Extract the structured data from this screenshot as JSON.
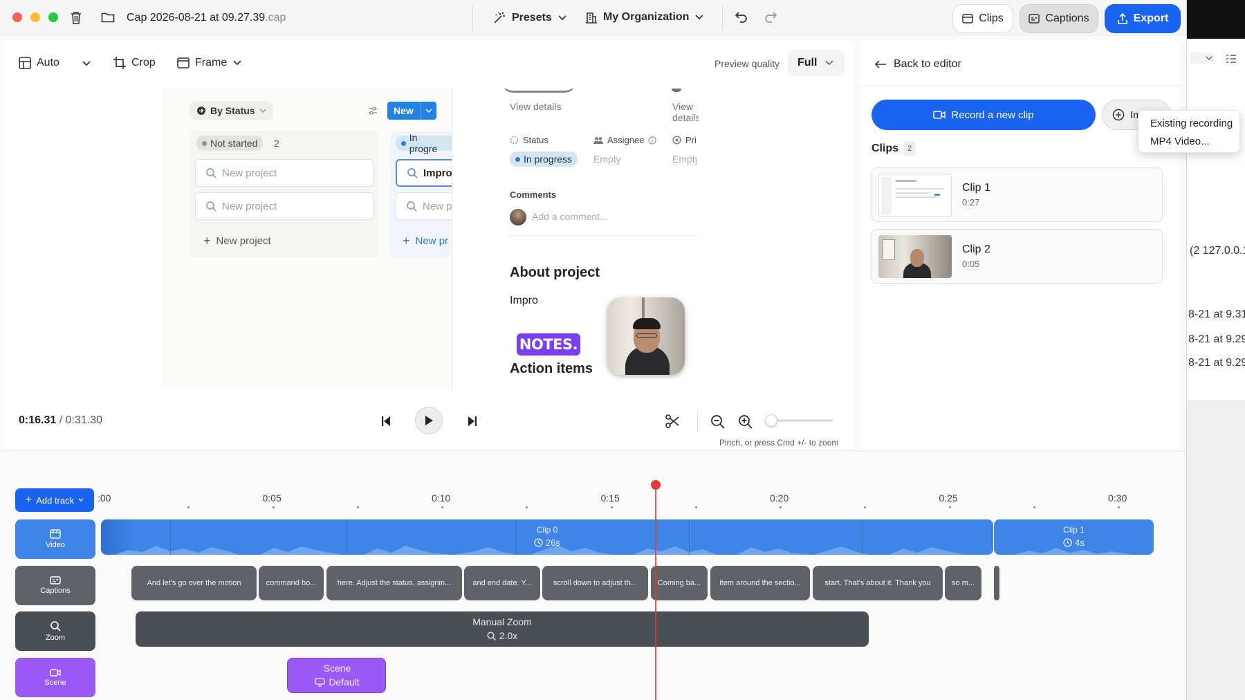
{
  "window": {
    "filename": "Cap 2026-08-21 at 09.27.39",
    "extension": ".cap"
  },
  "toolbar": {
    "presets": "Presets",
    "organization": "My Organization",
    "clips": "Clips",
    "captions": "Captions",
    "export": "Export"
  },
  "editor_bar": {
    "auto": "Auto",
    "crop": "Crop",
    "frame": "Frame",
    "preview_quality_label": "Preview quality",
    "preview_quality_value": "Full"
  },
  "preview": {
    "by_status": "By Status",
    "new_button": "New",
    "not_started": "Not started",
    "not_started_count": "2",
    "in_progress_col": "In progre",
    "new_project": "New project",
    "improv_card": "Improv",
    "new_pr": "New pr",
    "new_p": "New p",
    "view_details": "View details",
    "status_label": "Status",
    "assignee_label": "Assignee",
    "priority_label": "Pri",
    "status_value": "In progress",
    "assignee_value": "Empty",
    "priority_value": "Empty",
    "comments": "Comments",
    "add_comment": "Add a comment...",
    "about_project": "About project",
    "impro": "Impro",
    "notes_logo": "NOTES.",
    "action_items": "Action items"
  },
  "playback": {
    "current_time": "0:16.31",
    "separator": "/",
    "total_time": "0:31.30",
    "zoom_hint": "Pinch, or press Cmd +/- to zoom",
    "zoom_level": 0.02
  },
  "sidebar": {
    "back": "Back to editor",
    "record": "Record a new clip",
    "import": "Im",
    "clips_title": "Clips",
    "clips_count": "2",
    "clips": [
      {
        "name": "Clip 1",
        "duration": "0:27"
      },
      {
        "name": "Clip 2",
        "duration": "0:05"
      }
    ]
  },
  "import_menu": {
    "items": [
      "Existing recording",
      "MP4 Video..."
    ]
  },
  "timeline": {
    "add_track": "Add track",
    "ticks": [
      ":00",
      "0:05",
      "0:10",
      "0:15",
      "0:20",
      "0:25",
      "0:30"
    ],
    "tracks": [
      "Video",
      "Captions",
      "Zoom",
      "Scene"
    ],
    "video_clips": [
      {
        "name": "Clip 0",
        "duration": "26s"
      },
      {
        "name": "Clip 1",
        "duration": "4s"
      }
    ],
    "captions": [
      "And let's go over the motion",
      "command bo...",
      "here. Adjust the status, assignin...",
      "and end date. Y...",
      "scroll down to adjust th...",
      "Coming ba...",
      "item around the sectio...",
      "start. That's about it. Thank you",
      "so m..."
    ],
    "zoom_segment": {
      "name": "Manual Zoom",
      "value": "2.0x"
    },
    "scene_segment": {
      "name": "Scene",
      "value": "Default"
    },
    "playhead_time": 16.31
  },
  "background_app": {
    "text_lines": [
      "(2 127.0.0.1",
      "8-21 at 9.31",
      "8-21 at 9.29",
      "8-21 at 9.29"
    ]
  },
  "colors": {
    "accent": "#1a62f0",
    "video_track": "#3f85e8",
    "scene": "#9b59f5",
    "playhead": "#e53935",
    "caption_chip": "#5f6368",
    "zoom_track": "#4a4e55"
  }
}
